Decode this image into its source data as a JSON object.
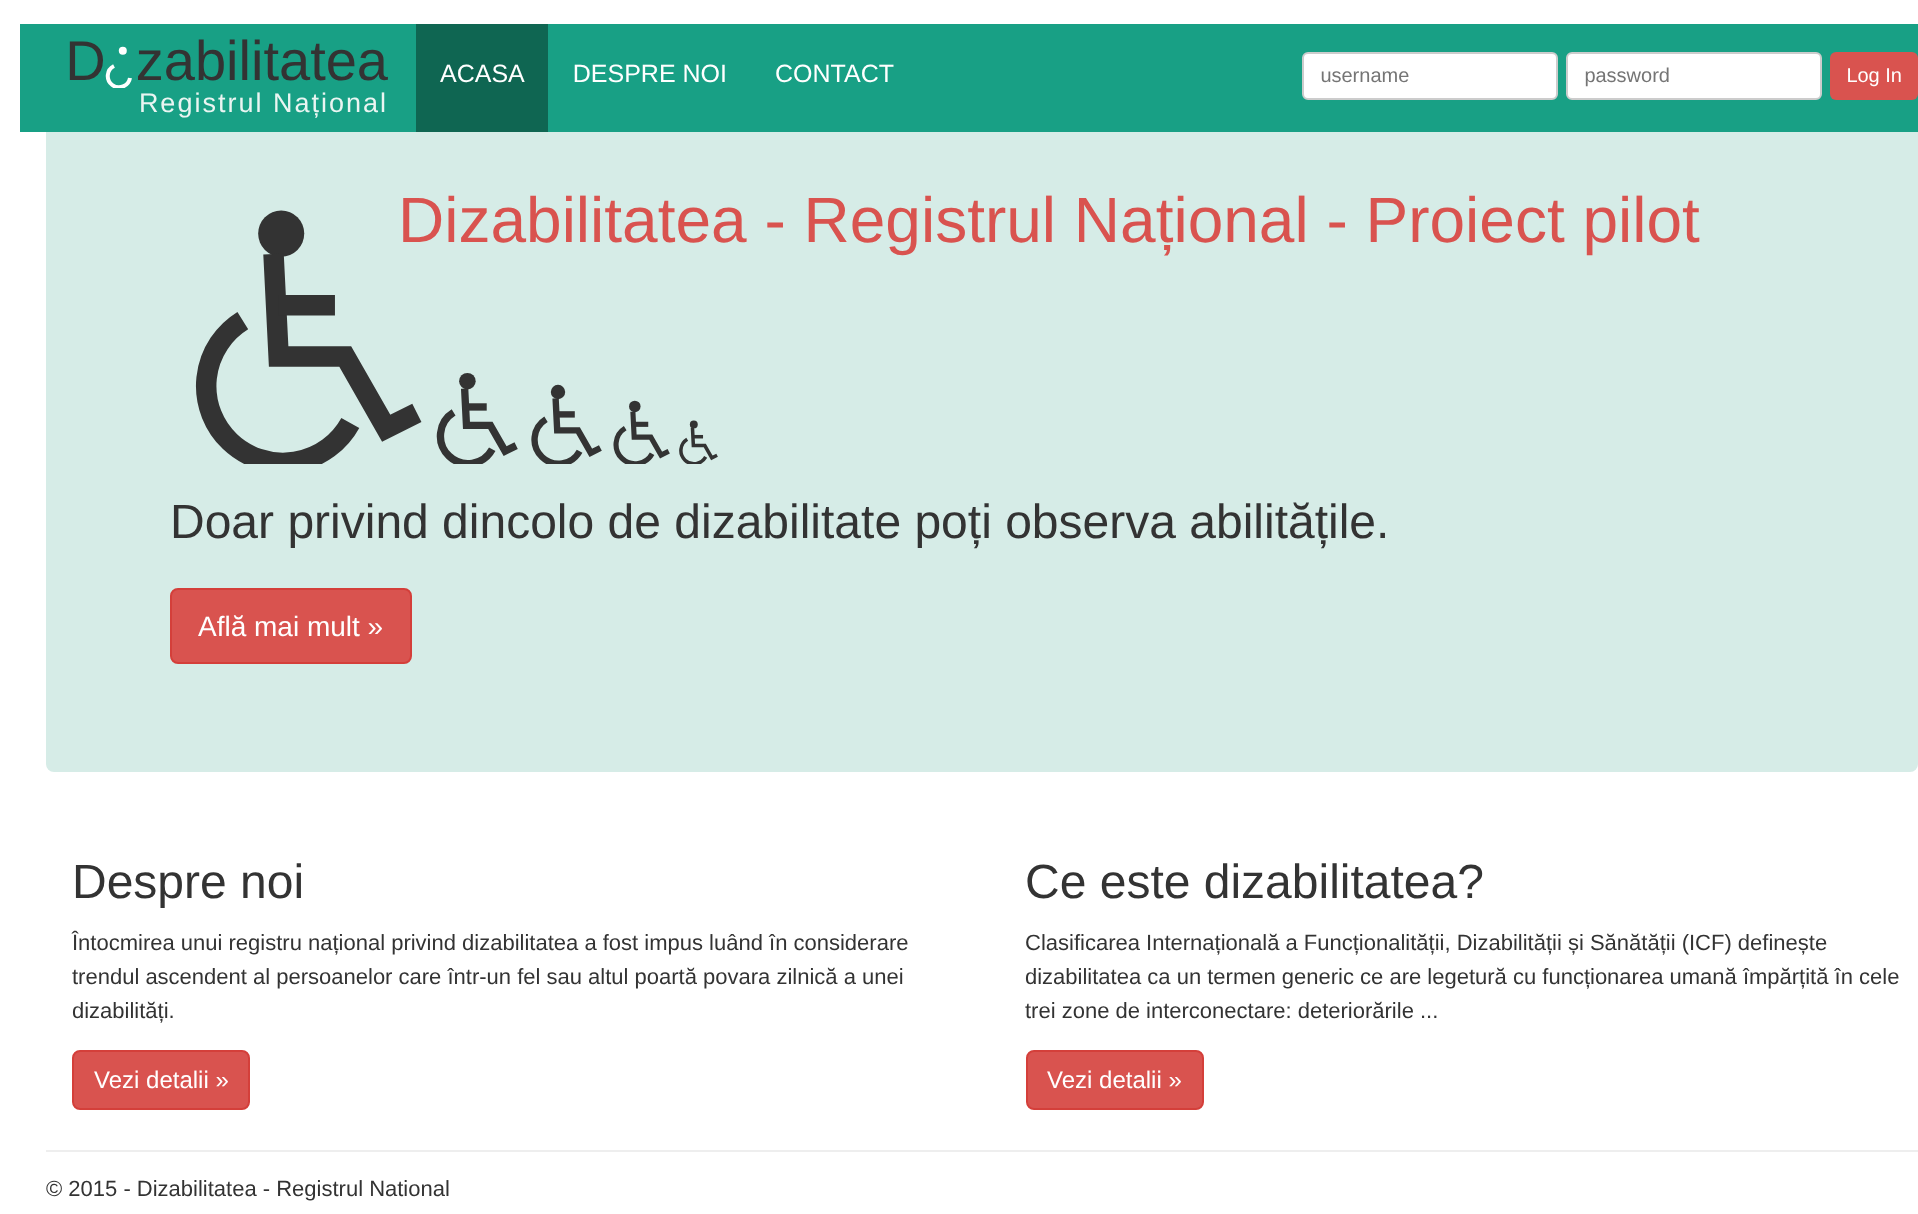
{
  "navbar": {
    "logo": {
      "before": "D",
      "after": "zabilitatea",
      "subtitle": "Registrul Național"
    },
    "links": [
      {
        "label": "ACASA",
        "selected": true
      },
      {
        "label": "DESPRE NOI",
        "selected": false
      },
      {
        "label": "CONTACT",
        "selected": false
      }
    ],
    "login": {
      "username_placeholder": "username",
      "password_placeholder": "password",
      "button": "Log In"
    }
  },
  "hero": {
    "title": "Dizabilitatea - Registrul Național - Proiect pilot",
    "tagline": "Doar privind dincolo de dizabilitate poți observa abilitățile.",
    "button": "Află mai mult »"
  },
  "columns": [
    {
      "heading": "Despre noi",
      "text": "Întocmirea unui registru național privind dizabilitatea a fost impus luând în considerare trendul ascendent al persoanelor care într-un fel sau altul poartă povara zilnică a unei dizabilități.",
      "button": "Vezi detalii »"
    },
    {
      "heading": "Ce este dizabilitatea?",
      "text": "Clasificarea Internațională a Funcționalității, Dizabilității și Sănătății (ICF) definește dizabilitatea ca un termen generic ce are legetură cu funcționarea umană împărțită în cele trei zone de interconectare: deteriorările ...",
      "button": "Vezi detalii »"
    }
  ],
  "footer": "© 2015 - Dizabilitatea - Registrul National"
}
